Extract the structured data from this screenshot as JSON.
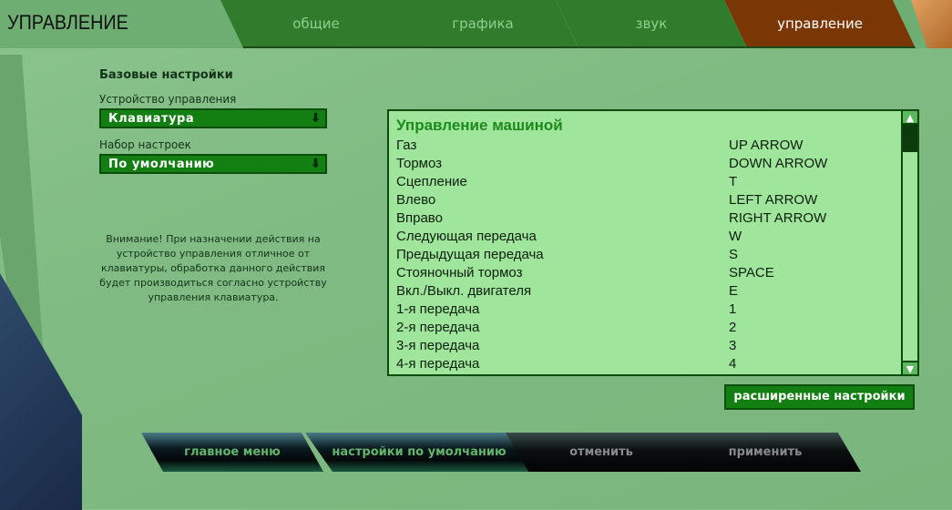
{
  "header": {
    "title": "УПРАВЛЕНИЕ",
    "tabs": [
      {
        "label": "общие"
      },
      {
        "label": "графика"
      },
      {
        "label": "звук"
      },
      {
        "label": "управление"
      }
    ]
  },
  "basic": {
    "heading": "Базовые настройки",
    "device_label": "Устройство управления",
    "device_value": "Клавиатура",
    "preset_label": "Набор настроек",
    "preset_value": "По умолчанию",
    "arrow": "⬇",
    "warning": "Внимание! При назначении действия на устройство управления отличное от клавиатуры, обработка данного действия будет производиться согласно устройству управления клавиатура."
  },
  "bindings": {
    "title": "Управление машиной",
    "rows": [
      {
        "action": "Газ",
        "key": "UP ARROW"
      },
      {
        "action": "Тормоз",
        "key": "DOWN ARROW"
      },
      {
        "action": "Сцепление",
        "key": "T"
      },
      {
        "action": "Влево",
        "key": "LEFT ARROW"
      },
      {
        "action": "Вправо",
        "key": "RIGHT ARROW"
      },
      {
        "action": "Следующая передача",
        "key": "W"
      },
      {
        "action": "Предыдущая передача",
        "key": "S"
      },
      {
        "action": "Стояночный тормоз",
        "key": "SPACE"
      },
      {
        "action": "Вкл./Выкл. двигателя",
        "key": "E"
      },
      {
        "action": "1-я передача",
        "key": "1"
      },
      {
        "action": "2-я передача",
        "key": "2"
      },
      {
        "action": "3-я передача",
        "key": "3"
      },
      {
        "action": "4-я передача",
        "key": "4"
      }
    ],
    "scroll_up": "▲",
    "scroll_down": "▼"
  },
  "advanced_label": "расширенные настройки",
  "footer": {
    "main_menu": "главное меню",
    "defaults": "настройки по умолчанию",
    "cancel": "отменить",
    "apply": "применить"
  }
}
